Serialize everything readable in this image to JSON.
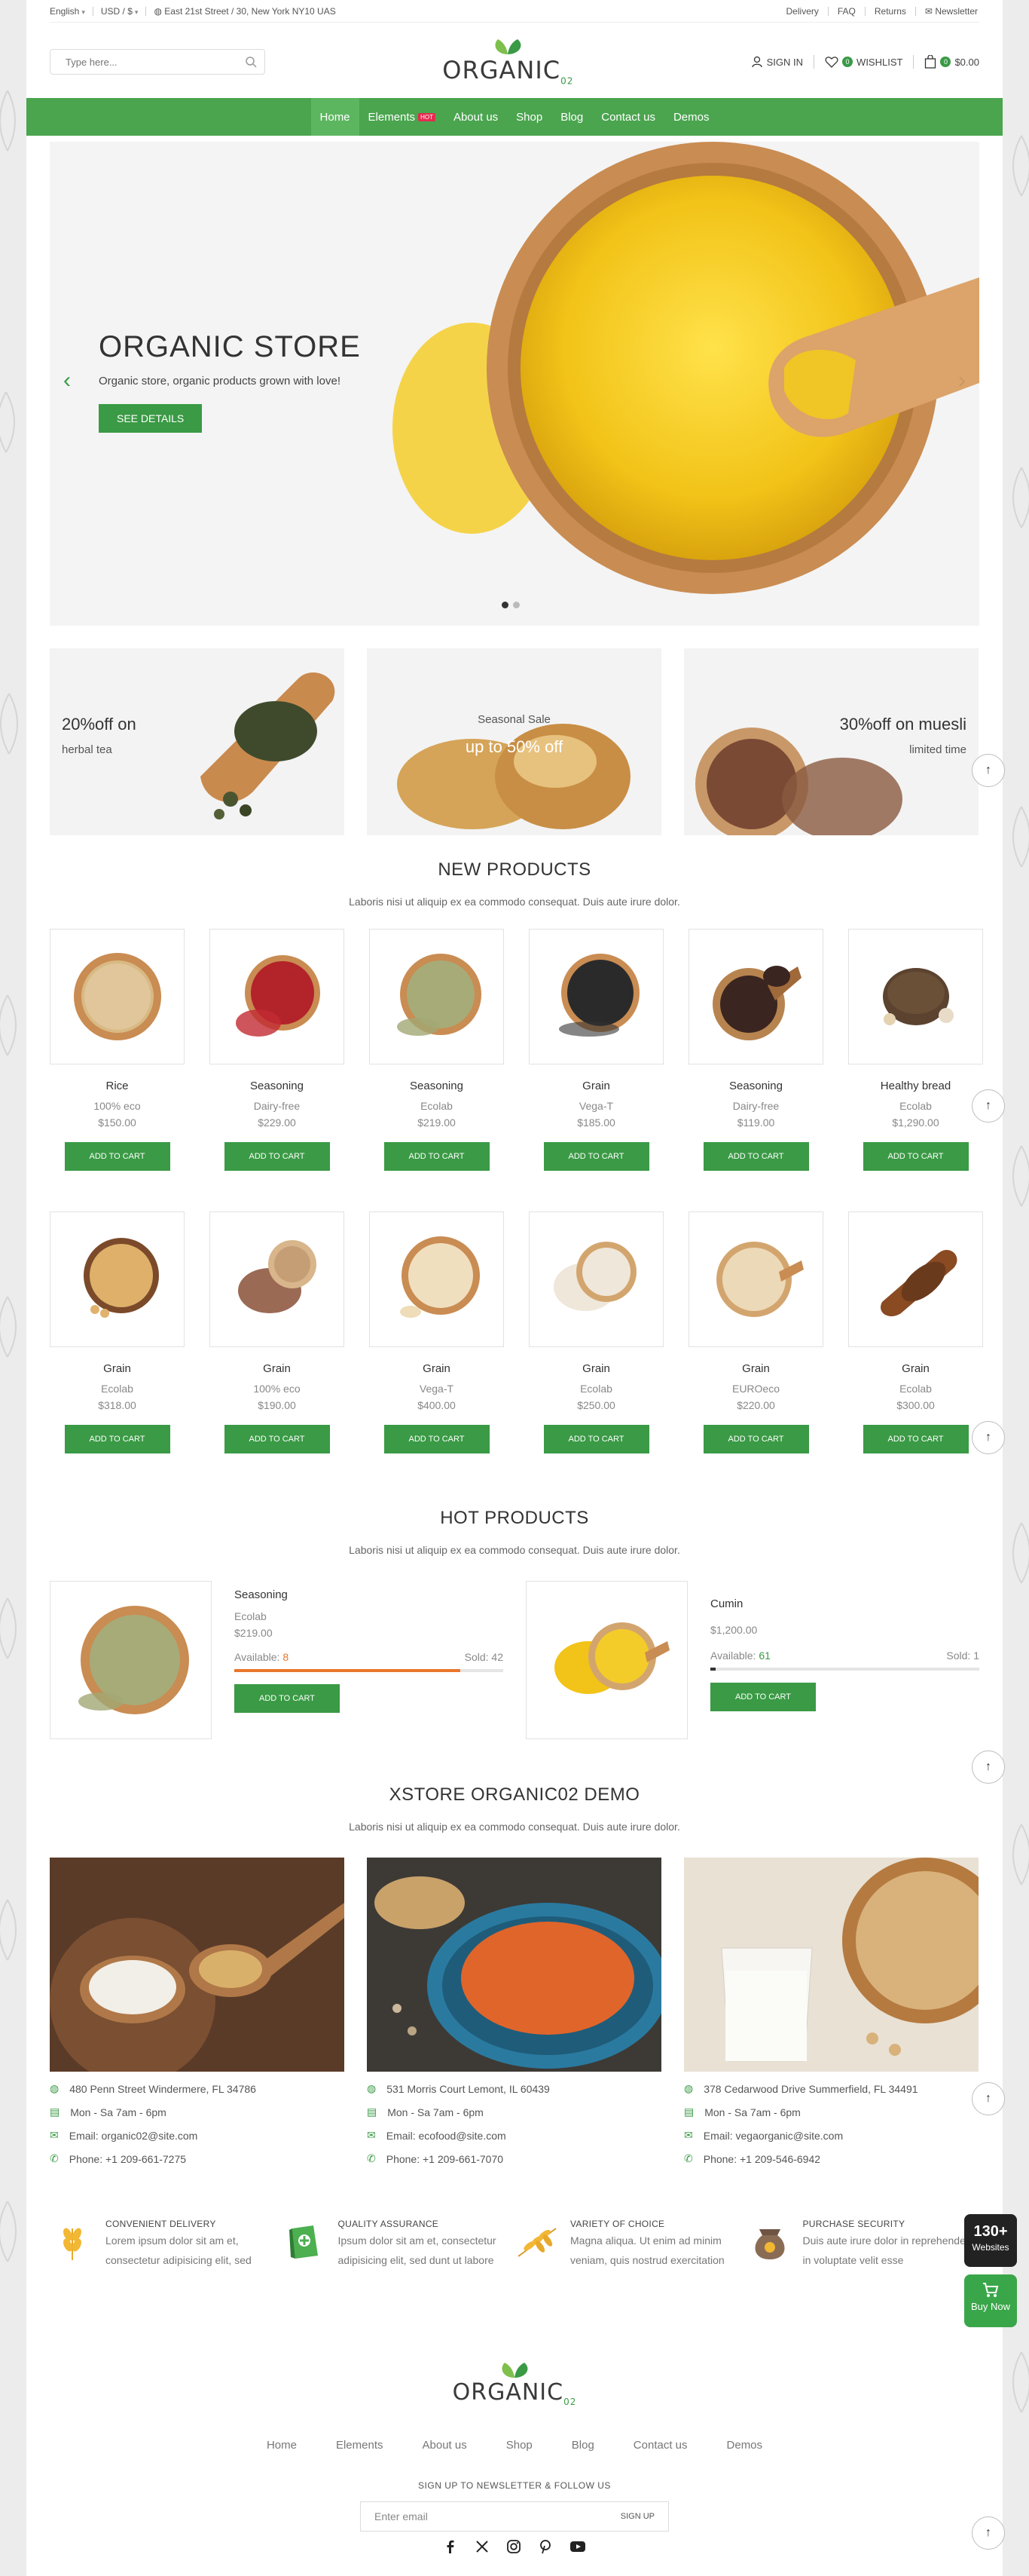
{
  "topbar": {
    "language": "English",
    "currency": "USD / $",
    "address": "East 21st Street / 30, New York NY10 UAS",
    "links": [
      "Delivery",
      "FAQ",
      "Returns",
      "Newsletter"
    ]
  },
  "header": {
    "search_placeholder": "Type here...",
    "logo_text": "ORGANIC",
    "logo_suffix": "02",
    "sign_in": "SIGN IN",
    "wishlist": "WISHLIST",
    "wishlist_count": "0",
    "cart_count": "0",
    "cart_total": "$0.00"
  },
  "nav": {
    "items": [
      "Home",
      "Elements",
      "About us",
      "Shop",
      "Blog",
      "Contact us",
      "Demos"
    ],
    "hot_badge": "HOT"
  },
  "hero": {
    "title": "ORGANIC STORE",
    "subtitle": "Organic store, organic products grown with love!",
    "button": "SEE DETAILS",
    "prev": "‹",
    "next": "›"
  },
  "promos": [
    {
      "line1": "20%off on",
      "line2": "herbal tea"
    },
    {
      "line1": "Seasonal Sale",
      "line2": "up to 50% off"
    },
    {
      "line1": "30%off on muesli",
      "line2": "limited time"
    }
  ],
  "new_products": {
    "title": "NEW PRODUCTS",
    "subtitle": "Laboris nisi ut aliquip ex ea commodo consequat. Duis aute irure dolor.",
    "cart_label": "ADD TO CART",
    "row1": [
      {
        "name": "Rice",
        "brand": "100% eco",
        "price": "$150.00"
      },
      {
        "name": "Seasoning",
        "brand": "Dairy-free",
        "price": "$229.00"
      },
      {
        "name": "Seasoning",
        "brand": "Ecolab",
        "price": "$219.00"
      },
      {
        "name": "Grain",
        "brand": "Vega-T",
        "price": "$185.00"
      },
      {
        "name": "Seasoning",
        "brand": "Dairy-free",
        "price": "$119.00"
      },
      {
        "name": "Healthy bread",
        "brand": "Ecolab",
        "price": "$1,290.00"
      }
    ],
    "row2": [
      {
        "name": "Grain",
        "brand": "Ecolab",
        "price": "$318.00"
      },
      {
        "name": "Grain",
        "brand": "100% eco",
        "price": "$190.00"
      },
      {
        "name": "Grain",
        "brand": "Vega-T",
        "price": "$400.00"
      },
      {
        "name": "Grain",
        "brand": "Ecolab",
        "price": "$250.00"
      },
      {
        "name": "Grain",
        "brand": "EUROeco",
        "price": "$220.00"
      },
      {
        "name": "Grain",
        "brand": "Ecolab",
        "price": "$300.00"
      }
    ]
  },
  "hot_products": {
    "title": "HOT PRODUCTS",
    "subtitle": "Laboris nisi ut aliquip ex ea commodo consequat. Duis aute irure dolor.",
    "items": [
      {
        "name": "Seasoning",
        "brand": "Ecolab",
        "price": "$219.00",
        "available_label": "Available:",
        "available": "8",
        "sold_label": "Sold:",
        "sold": "42",
        "button": "ADD TO CART"
      },
      {
        "name": "Cumin",
        "brand": "",
        "price": "$1,200.00",
        "available_label": "Available:",
        "available": "61",
        "sold_label": "Sold:",
        "sold": "1",
        "button": "ADD TO CART"
      }
    ]
  },
  "demo": {
    "title": "XSTORE ORGANIC02 DEMO",
    "subtitle": "Laboris nisi ut aliquip ex ea commodo consequat. Duis aute irure dolor.",
    "stores": [
      {
        "address": "480 Penn Street Windermere, FL 34786",
        "hours": "Mon - Sa 7am - 6pm",
        "email": "Email: organic02@site.com",
        "phone": "Phone: +1 209-661-7275"
      },
      {
        "address": "531 Morris Court Lemont, IL 60439",
        "hours": "Mon - Sa 7am - 6pm",
        "email": "Email: ecofood@site.com",
        "phone": "Phone: +1 209-661-7070"
      },
      {
        "address": "378 Cedarwood Drive Summerfield, FL 34491",
        "hours": "Mon - Sa 7am - 6pm",
        "email": "Email: vegaorganic@site.com",
        "phone": "Phone: +1 209-546-6942"
      }
    ]
  },
  "features": [
    {
      "title": "CONVENIENT DELIVERY",
      "text": "Lorem ipsum dolor sit am et, consectetur adipisicing elit, sed"
    },
    {
      "title": "QUALITY ASSURANCE",
      "text": "Ipsum dolor sit am et, consectetur adipisicing elit, sed dunt ut labore"
    },
    {
      "title": "VARIETY OF CHOICE",
      "text": "Magna aliqua. Ut enim ad minim veniam, quis nostrud exercitation"
    },
    {
      "title": "PURCHASE SECURITY",
      "text": "Duis aute irure dolor in reprehenderit in voluptate velit esse"
    }
  ],
  "footer": {
    "logo_text": "ORGANIC",
    "logo_suffix": "02",
    "links": [
      "Home",
      "Elements",
      "About us",
      "Shop",
      "Blog",
      "Contact us",
      "Demos"
    ],
    "newsletter_title": "SIGN UP TO NEWSLETTER & FOLLOW US",
    "email_placeholder": "Enter email",
    "signup": "SIGN UP",
    "socials": [
      "f",
      "x",
      "instagram",
      "pinterest",
      "youtube"
    ]
  },
  "floating": {
    "websites_count": "130+",
    "websites_label": "Websites",
    "buy_now": "Buy Now"
  },
  "colors": {
    "primary": "#3a9a45",
    "nav": "#4aa54e",
    "accent": "#e8762b"
  }
}
